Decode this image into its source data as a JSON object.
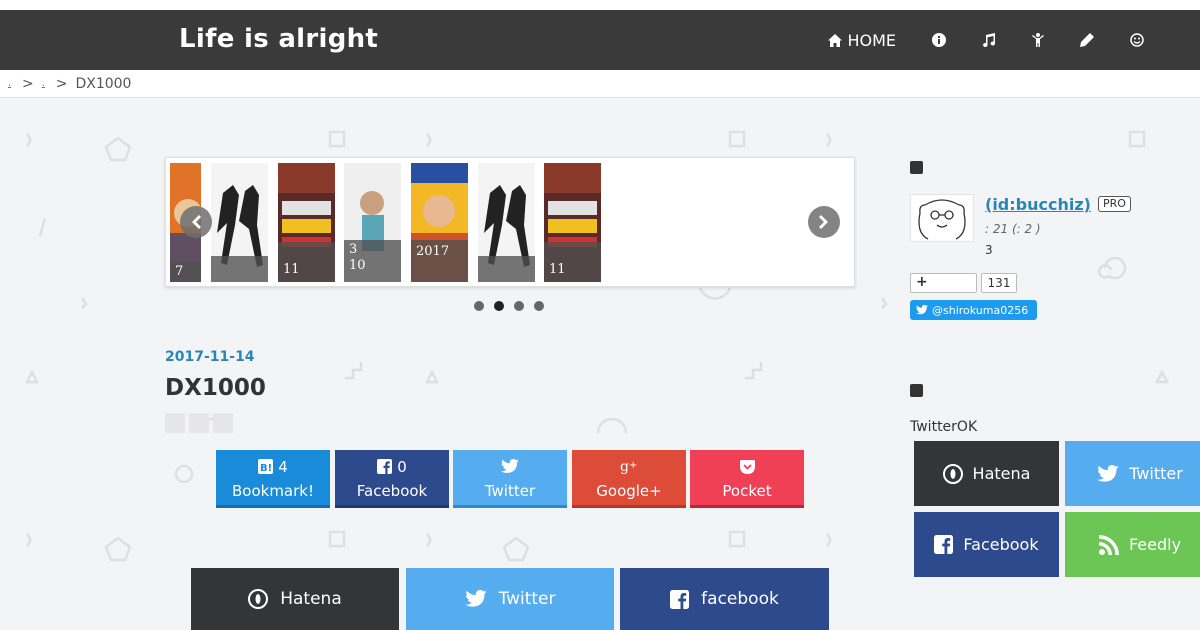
{
  "header": {
    "site_title": "Life is alright",
    "nav": [
      {
        "label": "HOME",
        "icon": "home-icon"
      },
      {
        "label": "",
        "icon": "info-icon"
      },
      {
        "label": "",
        "icon": "music-icon"
      },
      {
        "label": "",
        "icon": "child-icon"
      },
      {
        "label": "",
        "icon": "pencil-icon"
      },
      {
        "label": "",
        "icon": "smile-icon"
      }
    ]
  },
  "breadcrumb": {
    "link1": ".",
    "link2": ".",
    "separator": ">",
    "current": "DX1000"
  },
  "slider": {
    "slides": [
      {
        "caption": "7"
      },
      {
        "caption": ""
      },
      {
        "caption": "11"
      },
      {
        "caption": "3\n10"
      },
      {
        "caption": "2017"
      },
      {
        "caption": ""
      },
      {
        "caption": "11"
      }
    ],
    "dots": 4,
    "active_dot": 1
  },
  "post": {
    "date": "2017-11-14",
    "title": "DX1000"
  },
  "share": {
    "hatena": {
      "count": "4",
      "label": "Bookmark!",
      "color": "#1a8bd8"
    },
    "facebook": {
      "count": "0",
      "label": "Facebook",
      "color": "#2d4a8c"
    },
    "twitter": {
      "label": "Twitter",
      "color": "#55acee"
    },
    "googleplus": {
      "label": "Google+",
      "color": "#dd4b39"
    },
    "pocket": {
      "label": "Pocket",
      "color": "#ef4056"
    }
  },
  "bottom_share": {
    "hatena_label": "Hatena",
    "twitter_label": "Twitter",
    "facebook_label": "facebook"
  },
  "sidebar": {
    "profile": {
      "name": " (id:bucchiz)",
      "badge": "PRO",
      "meta": ":        21 (:        2 )",
      "count": "3",
      "follow_label": "+",
      "follow_count": "131",
      "twitter_handle": "@shirokuma0256"
    },
    "twitter_text": "TwitterOK",
    "buttons": {
      "hatena": "Hatena",
      "twitter": "Twitter",
      "facebook": "Facebook",
      "feedly": "Feedly"
    }
  },
  "colors": {
    "header_bg": "#3a3a3a",
    "link": "#2a86b8",
    "hatena_dark": "#333539",
    "twitter": "#55acee",
    "facebook": "#2d4a8c",
    "feedly": "#6cc655"
  }
}
